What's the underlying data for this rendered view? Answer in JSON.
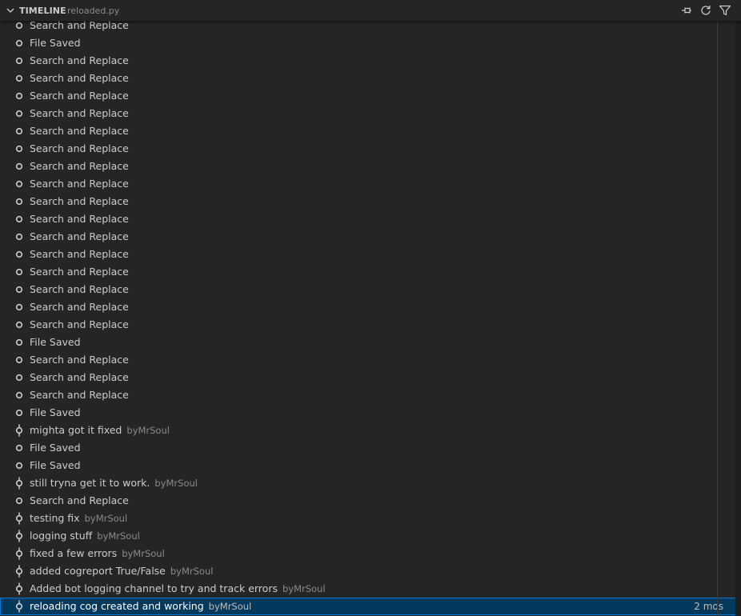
{
  "header": {
    "title": "TIMELINE",
    "file": "reloaded.py",
    "pin_icon": "pin-icon",
    "refresh_icon": "refresh-icon",
    "filter_icon": "filter-icon"
  },
  "colors": {
    "background": "#252526",
    "selection": "#04395e",
    "selection_border": "#0078d4",
    "text": "#cccccc",
    "description": "#8b8b8b"
  },
  "timeline": {
    "items": [
      {
        "label": "Search and Replace",
        "type": "local"
      },
      {
        "label": "File Saved",
        "type": "local"
      },
      {
        "label": "Search and Replace",
        "type": "local"
      },
      {
        "label": "Search and Replace",
        "type": "local"
      },
      {
        "label": "Search and Replace",
        "type": "local"
      },
      {
        "label": "Search and Replace",
        "type": "local"
      },
      {
        "label": "Search and Replace",
        "type": "local"
      },
      {
        "label": "Search and Replace",
        "type": "local"
      },
      {
        "label": "Search and Replace",
        "type": "local"
      },
      {
        "label": "Search and Replace",
        "type": "local"
      },
      {
        "label": "Search and Replace",
        "type": "local"
      },
      {
        "label": "Search and Replace",
        "type": "local"
      },
      {
        "label": "Search and Replace",
        "type": "local"
      },
      {
        "label": "Search and Replace",
        "type": "local"
      },
      {
        "label": "Search and Replace",
        "type": "local"
      },
      {
        "label": "Search and Replace",
        "type": "local"
      },
      {
        "label": "Search and Replace",
        "type": "local"
      },
      {
        "label": "Search and Replace",
        "type": "local"
      },
      {
        "label": "File Saved",
        "type": "local"
      },
      {
        "label": "Search and Replace",
        "type": "local"
      },
      {
        "label": "Search and Replace",
        "type": "local"
      },
      {
        "label": "Search and Replace",
        "type": "local"
      },
      {
        "label": "File Saved",
        "type": "local"
      },
      {
        "label": "mighta got it fixed",
        "type": "git",
        "description": "byMrSoul"
      },
      {
        "label": "File Saved",
        "type": "local"
      },
      {
        "label": "File Saved",
        "type": "local"
      },
      {
        "label": "still tryna get it to work.",
        "type": "git",
        "description": "byMrSoul"
      },
      {
        "label": "Search and Replace",
        "type": "local"
      },
      {
        "label": "testing fix",
        "type": "git",
        "description": "byMrSoul"
      },
      {
        "label": "logging stuff",
        "type": "git",
        "description": "byMrSoul"
      },
      {
        "label": "fixed a few errors",
        "type": "git",
        "description": "byMrSoul"
      },
      {
        "label": "added cogreport True/False",
        "type": "git",
        "description": "byMrSoul"
      },
      {
        "label": "Added bot logging channel to try and track errors",
        "type": "git",
        "description": "byMrSoul"
      },
      {
        "label": "reloading cog created and working",
        "type": "git",
        "description": "byMrSoul",
        "time": "2 mos",
        "selected": true
      }
    ]
  }
}
